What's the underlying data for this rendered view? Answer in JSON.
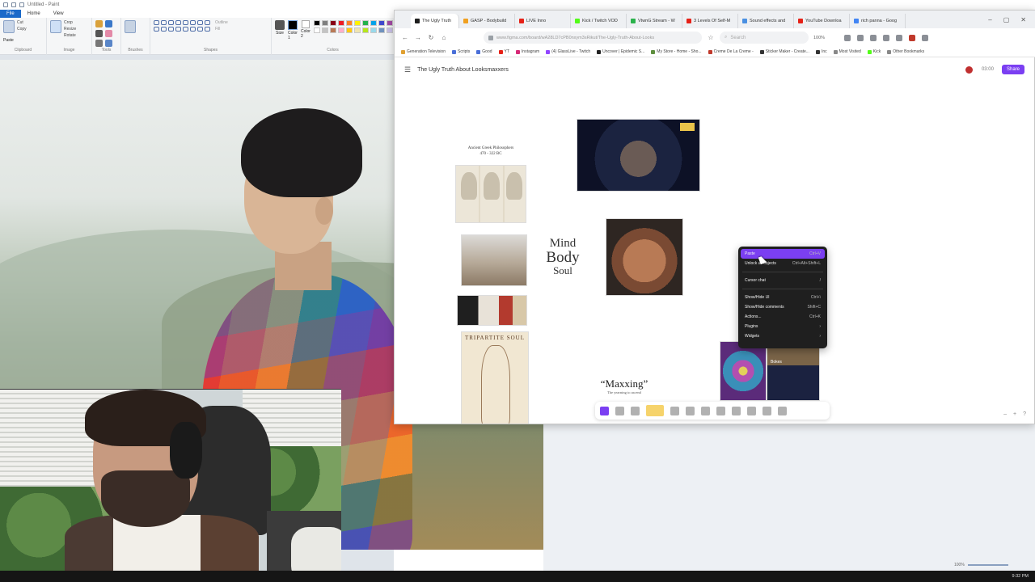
{
  "paint": {
    "title": "Untitled - Paint",
    "tabs": [
      "File",
      "Home",
      "View"
    ],
    "groups": {
      "clipboard": "Clipboard",
      "image": "Image",
      "tools": "Tools",
      "shapes": "Shapes",
      "colors": "Colors"
    },
    "labels": {
      "paste": "Paste",
      "cut": "Cut",
      "copy": "Copy",
      "select": "Select",
      "crop": "Crop",
      "resize": "Resize",
      "rotate": "Rotate",
      "brushes": "Brushes",
      "outline": "Outline",
      "fill": "Fill",
      "size": "Size",
      "color1": "Color 1",
      "color2": "Color 2"
    },
    "palette": [
      "#000000",
      "#7f7f7f",
      "#880015",
      "#ed1c24",
      "#ff7f27",
      "#fff200",
      "#22b14c",
      "#00a2e8",
      "#3f48cc",
      "#a349a4",
      "#ffffff",
      "#c3c3c3",
      "#b97a57",
      "#ffaec9",
      "#ffc90e",
      "#efe4b0",
      "#b5e61d",
      "#99d9ea",
      "#7092be",
      "#c8bfe7"
    ]
  },
  "browser": {
    "tabs": [
      {
        "label": "The Ugly Truth",
        "color": "#1e1e1e",
        "active": true
      },
      {
        "label": "GASP - Bodybuild",
        "color": "#f0a020"
      },
      {
        "label": "LIVE Inno",
        "color": "#e62117"
      },
      {
        "label": "Kick / Twitch VOD",
        "color": "#53fc18"
      },
      {
        "label": "VtwnG Stream - W",
        "color": "#2bb24c"
      },
      {
        "label": "3 Levels Of Self-M",
        "color": "#e62117"
      },
      {
        "label": "Sound effects and",
        "color": "#4a90e2"
      },
      {
        "label": "YouTube Downloa",
        "color": "#e62117"
      },
      {
        "label": "rich panna - Goog",
        "color": "#4285f4"
      }
    ],
    "url": "www.figma.com/board/wA28LD7cPB0nxym3sRikut/The-Ugly-Truth-About-Looks",
    "search_placeholder": "Search",
    "zoom": "100%",
    "bookmarks": [
      {
        "label": "Generation Television",
        "color": "#e0a030"
      },
      {
        "label": "Scripts",
        "color": "#4a6fd8"
      },
      {
        "label": "Good",
        "color": "#4a6fd8"
      },
      {
        "label": "YT",
        "color": "#e62117"
      },
      {
        "label": "Instagram",
        "color": "#d62976"
      },
      {
        "label": "(4) GlassLive - Twitch",
        "color": "#9146ff"
      },
      {
        "label": "Uncover | Epidemic S...",
        "color": "#222222"
      },
      {
        "label": "My Store - Home - Sho...",
        "color": "#5e8e3e"
      },
      {
        "label": "Creme De La Creme -",
        "color": "#c0392b"
      },
      {
        "label": "Sticker Maker - Create...",
        "color": "#333333"
      },
      {
        "label": "Inc",
        "color": "#333333"
      },
      {
        "label": "Most Visited",
        "color": "#888888"
      },
      {
        "label": "Kick",
        "color": "#53fc18"
      },
      {
        "label": "Other Bookmarks",
        "color": "#888888"
      }
    ]
  },
  "figma": {
    "file_name": "The Ugly Truth About Looksmaxxers",
    "timer": "03:00",
    "share_label": "Share",
    "board": {
      "greek_title": "Ancient Greek Philosophers",
      "greek_dates": "470 - 322 BC",
      "mind": "Mind",
      "body": "Body",
      "soul": "Soul",
      "tripartite": "TRIPARTITE SOUL",
      "maxxing": "“Maxxing”",
      "maxxing_sub": "The yearning to ascend",
      "psy_label": "Bokes"
    },
    "context_menu": [
      {
        "label": "Paste",
        "shortcut": "Ctrl+V",
        "active": true
      },
      {
        "label": "Unlock all objects",
        "shortcut": "Ctrl+Alt+Shift+L"
      },
      {
        "separator": true
      },
      {
        "label": "Cursor chat",
        "shortcut": "/"
      },
      {
        "separator": true
      },
      {
        "label": "Show/Hide UI",
        "shortcut": "Ctrl+\\"
      },
      {
        "label": "Show/Hide comments",
        "shortcut": "Shift+C"
      },
      {
        "label": "Actions...",
        "shortcut": "Ctrl+K"
      },
      {
        "label": "Plugins",
        "shortcut": "›"
      },
      {
        "label": "Widgets",
        "shortcut": "›"
      }
    ]
  },
  "status": {
    "zoom": "100%",
    "clock": "9:32 PM"
  }
}
